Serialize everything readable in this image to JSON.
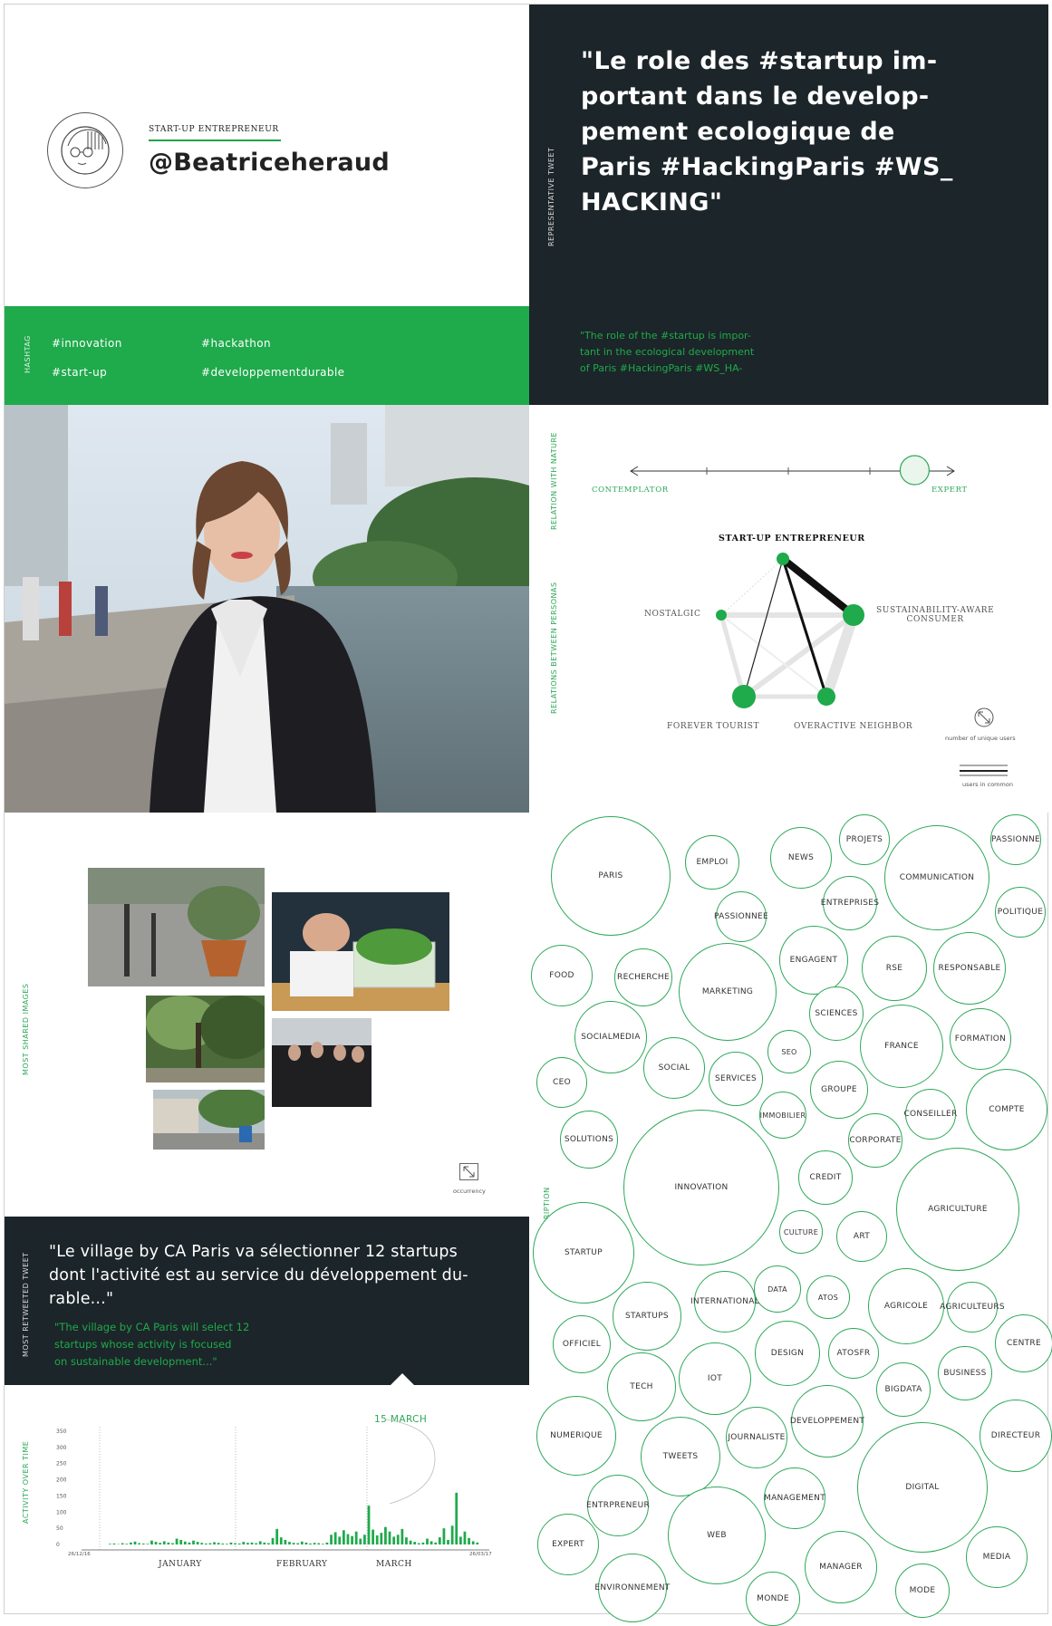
{
  "colors": {
    "green": "#1faa4b",
    "dark": "#1c2529",
    "text": "#222222"
  },
  "profile": {
    "role": "START-UP ENTREPRENEUR",
    "handle": "@Beatriceheraud",
    "avatar_icon": "user-portrait-icon"
  },
  "hashtags": {
    "side_label": "HASHTAG",
    "items": [
      "#innovation",
      "#hackathon",
      "#start-up",
      "#developpementdurable"
    ]
  },
  "representative_tweet": {
    "side_label": "REPRESENTATIVE TWEET",
    "lines": [
      "\"Le role des #startup im-",
      "portant dans le develop-",
      "pement ecologique de",
      "Paris #HackingParis #WS_",
      "HACKING\""
    ],
    "translation_lines": [
      "\"The role of the #startup is impor-",
      "tant in the ecological development",
      "of Paris #HackingParis #WS_HA-"
    ]
  },
  "nature": {
    "side_label": "RELATION WITH NATURE",
    "left": "CONTEMPLATOR",
    "right": "EXPERT",
    "level": 0.88
  },
  "personas": {
    "side_label": "RELATIONS BETWEEN PERSONAS",
    "center": "START-UP ENTREPRENEUR",
    "nostalgic": "NOSTALGIC",
    "sustain_line1": "SUSTAINABILITY-AWARE",
    "sustain_line2": "CONSUMER",
    "tourist": "FOREVER TOURIST",
    "neighbor": "OVERACTIVE NEIGHBOR",
    "legend_users": "number of unique users",
    "legend_common": "users in common"
  },
  "images": {
    "side_label": "MOST SHARED IMAGES",
    "occurrency": "occurrency"
  },
  "retweet": {
    "side_label": "MOST RETWEETED TWEET",
    "lines": [
      "\"Le village by CA Paris va sélectionner 12 startups",
      "dont l'activité est au service du développement du-",
      "rable...\""
    ],
    "translation_lines": [
      "\"The village by CA Paris will select 12",
      "startups whose activity is focused",
      "on sustainable development...\""
    ]
  },
  "activity": {
    "side_label": "ACTIVITY OVER TIME",
    "highlight": "15 MARCH",
    "start": "26/12/16",
    "end": "26/03/17"
  },
  "chart_data": {
    "type": "bar",
    "title": "",
    "xlabel": "",
    "ylabel": "",
    "ylim": [
      0,
      350
    ],
    "yticks": [
      350,
      300,
      250,
      200,
      150,
      100,
      50,
      0
    ],
    "month_labels": [
      "JANUARY",
      "FEBRUARY",
      "MARCH"
    ],
    "values": [
      2,
      3,
      1,
      4,
      2,
      6,
      9,
      4,
      3,
      2,
      12,
      8,
      5,
      10,
      6,
      4,
      18,
      14,
      9,
      6,
      12,
      8,
      5,
      3,
      4,
      7,
      5,
      3,
      2,
      6,
      4,
      3,
      8,
      5,
      6,
      4,
      10,
      6,
      4,
      20,
      48,
      22,
      14,
      8,
      5,
      4,
      9,
      6,
      3,
      5,
      4,
      2,
      6,
      30,
      38,
      24,
      44,
      32,
      26,
      40,
      18,
      30,
      120,
      46,
      28,
      36,
      54,
      40,
      24,
      30,
      48,
      22,
      12,
      8,
      4,
      6,
      18,
      10,
      6,
      22,
      50,
      14,
      58,
      160,
      24,
      40,
      20,
      10,
      6
    ]
  },
  "description": {
    "side_label": "DESCRIPTION",
    "words": [
      "PARIS",
      "EMPLOI",
      "NEWS",
      "PROJETS",
      "COMMUNICATION",
      "PASSIONNE",
      "POLITIQUE",
      "PASSIONNEE",
      "ENTREPRISES",
      "FOOD",
      "RECHERCHE",
      "MARKETING",
      "ENGAGENT",
      "RSE",
      "RESPONSABLE",
      "SCIENCES",
      "SOCIALMEDIA",
      "SEO",
      "FRANCE",
      "FORMATION",
      "SOCIAL",
      "SERVICES",
      "GROUPE",
      "CEO",
      "IMMOBILIER",
      "CONSEILLER",
      "COMPTE",
      "SOLUTIONS",
      "CORPORATE",
      "CREDIT",
      "INNOVATION",
      "AGRICULTURE",
      "CULTURE",
      "ART",
      "STARTUP",
      "DATA",
      "ATOS",
      "INTERNATIONAL",
      "STARTUPS",
      "AGRICOLE",
      "AGRICULTEURS",
      "CENTRE",
      "OFFICIEL",
      "DESIGN",
      "ATOSFR",
      "BUSINESS",
      "IOT",
      "TECH",
      "BIGDATA",
      "DEVELOPPEMENT",
      "NUMERIQUE",
      "TWEETS",
      "JOURNALISTE",
      "DIRECTEUR",
      "MANAGEMENT",
      "DIGITAL",
      "ENTRPRENEUR",
      "WEB",
      "EXPERT",
      "MANAGER",
      "MEDIA",
      "ENVIRONNEMENT",
      "MONDE",
      "MODE"
    ]
  }
}
